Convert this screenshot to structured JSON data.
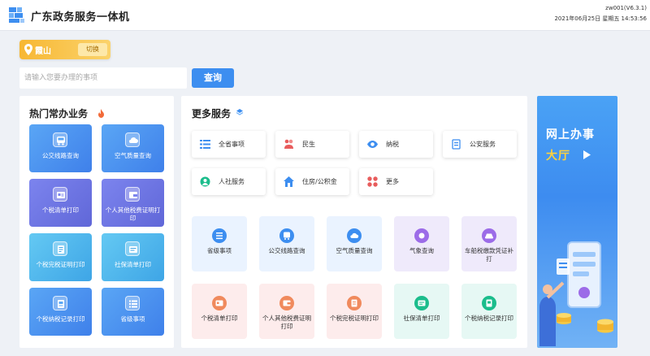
{
  "header": {
    "title": "广东政务服务一体机",
    "version": "zw001(V6.3.1)",
    "datetime": "2021年06月25日 星期五 14:53:56"
  },
  "location": {
    "name": "霞山",
    "switch_label": "切换"
  },
  "search": {
    "placeholder": "请输入您要办理的事项",
    "button_label": "查询"
  },
  "hot": {
    "title": "热门常办业务",
    "items": [
      {
        "label": "公交线路查询",
        "icon": "bus-icon"
      },
      {
        "label": "空气质量查询",
        "icon": "cloud-icon"
      },
      {
        "label": "个税清单打印",
        "icon": "id-card-icon"
      },
      {
        "label": "个人其他税费证明打印",
        "icon": "wallet-icon"
      },
      {
        "label": "个税完税证明打印",
        "icon": "document-icon"
      },
      {
        "label": "社保清单打印",
        "icon": "list-icon"
      },
      {
        "label": "个税纳税记录打印",
        "icon": "record-icon"
      },
      {
        "label": "省级事项",
        "icon": "list-icon"
      }
    ]
  },
  "more": {
    "title": "更多服务",
    "buttons": [
      {
        "label": "全省事项",
        "icon": "list-icon",
        "color": "#3d8ef0"
      },
      {
        "label": "民生",
        "icon": "people-icon",
        "color": "#e85c5c"
      },
      {
        "label": "纳税",
        "icon": "eye-icon",
        "color": "#3d8ef0"
      },
      {
        "label": "公安服务",
        "icon": "police-icon",
        "color": "#3d8ef0"
      },
      {
        "label": "人社服务",
        "icon": "social-icon",
        "color": "#1bbd8c"
      },
      {
        "label": "住房/公积金",
        "icon": "house-icon",
        "color": "#3d8ef0"
      },
      {
        "label": "更多",
        "icon": "grid-icon",
        "color": "#e85c5c"
      }
    ],
    "cards": [
      {
        "label": "省级事项",
        "icon": "list-icon",
        "color": "#3d8ef0"
      },
      {
        "label": "公交线路查询",
        "icon": "bus-icon",
        "color": "#3d8ef0"
      },
      {
        "label": "空气质量查询",
        "icon": "cloud-icon",
        "color": "#3d8ef0"
      },
      {
        "label": "气象查询",
        "icon": "weather-icon",
        "color": "#9c6ce8"
      },
      {
        "label": "车船税缴款凭证补打",
        "icon": "car-icon",
        "color": "#9c6ce8"
      },
      {
        "label": "个税清单打印",
        "icon": "id-card-icon",
        "color": "#f08a5d"
      },
      {
        "label": "个人其他税费证明打印",
        "icon": "wallet-icon",
        "color": "#f08a5d"
      },
      {
        "label": "个税完税证明打印",
        "icon": "document-icon",
        "color": "#f08a5d"
      },
      {
        "label": "社保清单打印",
        "icon": "list-icon",
        "color": "#1bbd8c"
      },
      {
        "label": "个税纳税记录打印",
        "icon": "record-icon",
        "color": "#1bbd8c"
      }
    ]
  },
  "banner": {
    "line1": "网上办事",
    "line2": "大厅"
  }
}
